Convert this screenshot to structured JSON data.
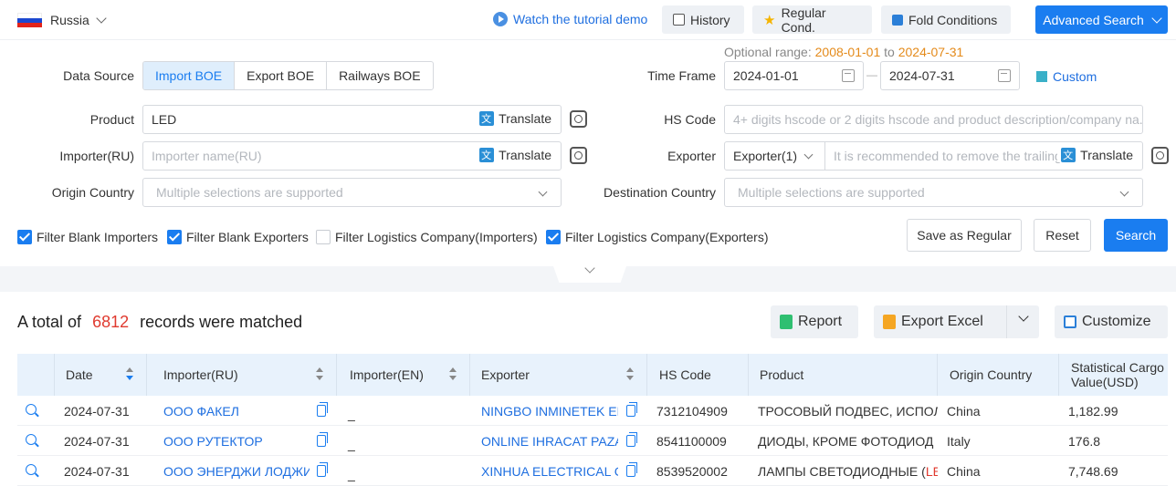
{
  "topbar": {
    "country": "Russia",
    "tutorial": "Watch the tutorial demo",
    "history": "History",
    "regular": "Regular Cond.",
    "fold": "Fold Conditions",
    "advanced": "Advanced Search",
    "colors": {
      "accent": "#1a7df0",
      "flag": [
        "#ffffff",
        "#1c48d0",
        "#e2231a"
      ]
    }
  },
  "form": {
    "data_source_label": "Data Source",
    "data_source_options": [
      "Import BOE",
      "Export BOE",
      "Railways BOE"
    ],
    "data_source_selected": "Import BOE",
    "optional_prefix": "Optional range:",
    "optional_from": "2008-01-01",
    "optional_to_word": "to",
    "optional_to": "2024-07-31",
    "time_frame_label": "Time Frame",
    "date_from": "2024-01-01",
    "date_sep": "—",
    "date_to": "2024-07-31",
    "custom": "Custom",
    "product_label": "Product",
    "product_value": "LED",
    "translate": "Translate",
    "hs_label": "HS Code",
    "hs_placeholder": "4+ digits hscode or 2 digits hscode and product description/company na...",
    "importer_label": "Importer(RU)",
    "importer_placeholder": "Importer name(RU)",
    "exporter_label": "Exporter",
    "exporter_select": "Exporter(1)",
    "exporter_placeholder": "It is recommended to remove the trailing",
    "origin_label": "Origin Country",
    "origin_placeholder": "Multiple selections are supported",
    "dest_label": "Destination Country",
    "dest_placeholder": "Multiple selections are supported"
  },
  "filters": [
    {
      "label": "Filter Blank Importers",
      "checked": true
    },
    {
      "label": "Filter Blank Exporters",
      "checked": true
    },
    {
      "label": "Filter Logistics Company(Importers)",
      "checked": false
    },
    {
      "label": "Filter Logistics Company(Exporters)",
      "checked": true
    }
  ],
  "actions": {
    "save": "Save as Regular",
    "reset": "Reset",
    "search": "Search"
  },
  "results": {
    "prefix": "A total of",
    "count": "6812",
    "suffix": "records were matched",
    "report": "Report",
    "export": "Export Excel",
    "customize": "Customize"
  },
  "table": {
    "columns": [
      "Date",
      "Importer(RU)",
      "Importer(EN)",
      "Exporter",
      "HS Code",
      "Product",
      "Origin Country",
      "Statistical Cargo Value(USD)"
    ],
    "rows": [
      {
        "date": "2024-07-31",
        "importer_ru": "ООО ФАКЕЛ",
        "importer_en": "_",
        "exporter": "NINGBO INMINETEK EL",
        "hs": "7312104909",
        "product": "ТРОСОВЫЙ ПОДВЕС, ИСПОЛ",
        "product_hl": "",
        "origin": "China",
        "value": "1,182.99"
      },
      {
        "date": "2024-07-31",
        "importer_ru": "ООО РУТЕКТОР",
        "importer_en": "_",
        "exporter": "ONLINE IHRACAT PAZA",
        "hs": "8541100009",
        "product": "ДИОДЫ, КРОМЕ ФОТОДИОД",
        "product_hl": "",
        "origin": "Italy",
        "value": "176.8"
      },
      {
        "date": "2024-07-31",
        "importer_ru": "ООО ЭНЕРДЖИ ЛОДЖИС",
        "importer_en": "_",
        "exporter": "XINHUA ELECTRICAL C",
        "hs": "8539520002",
        "product": "ЛАМПЫ СВЕТОДИОДНЫЕ (",
        "product_hl": "LE",
        "origin": "China",
        "value": "7,748.69"
      }
    ]
  }
}
